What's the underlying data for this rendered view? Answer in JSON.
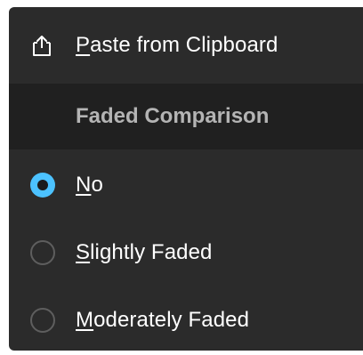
{
  "menu": {
    "paste": {
      "icon": "paste-icon",
      "accel": "P",
      "rest": "aste from Clipboard"
    },
    "section_header": "Faded Comparison",
    "options": [
      {
        "accel": "N",
        "rest": "o",
        "checked": true
      },
      {
        "accel": "S",
        "rest": "lightly Faded",
        "checked": false
      },
      {
        "accel": "M",
        "rest": "oderately Faded",
        "checked": false
      }
    ]
  },
  "colors": {
    "menu_background": "#2b2b2b",
    "header_background": "#202020",
    "accent": "#4cc2ff",
    "text": "#ffffff",
    "header_text": "#b4b4b4"
  }
}
